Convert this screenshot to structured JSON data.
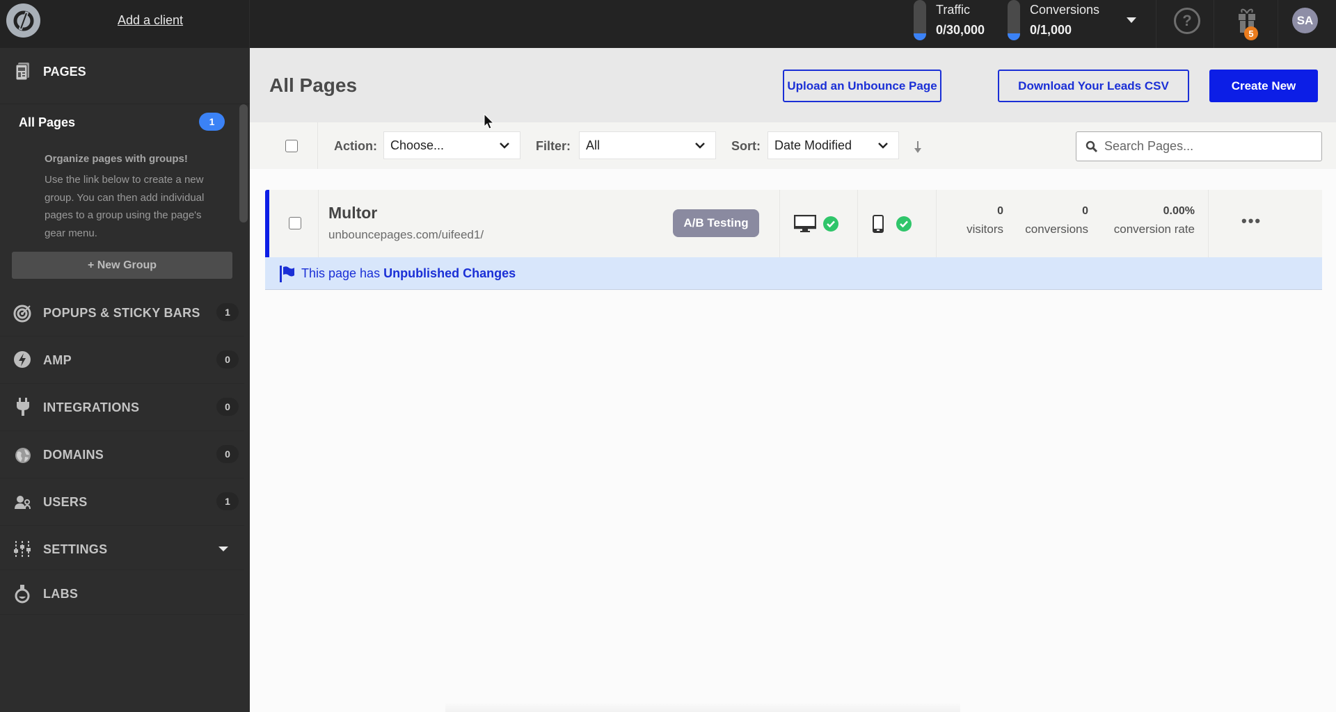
{
  "topbar": {
    "logo_icon": "unbounce-logo-icon",
    "add_client_label": "Add a client",
    "traffic": {
      "label": "Traffic",
      "value": "0/30,000",
      "fill_fraction": 0
    },
    "conversions": {
      "label": "Conversions",
      "value": "0/1,000",
      "fill_fraction": 0
    },
    "help_icon": "question-circle-icon",
    "help_glyph": "?",
    "gift_icon": "gift-icon",
    "gift_badge": "5",
    "avatar_initials": "SA"
  },
  "sidebar": {
    "pages_label": "PAGES",
    "all_pages": {
      "label": "All Pages",
      "count": "1"
    },
    "groups_help": {
      "title": "Organize pages with groups!",
      "text": "Use the link below to create a new group. You can then add individual pages to a group using the page's gear menu."
    },
    "new_group_label": "+ New Group",
    "items": [
      {
        "label": "POPUPS & STICKY BARS",
        "count": "1",
        "icon": "target-icon"
      },
      {
        "label": "AMP",
        "count": "0",
        "icon": "lightning-icon"
      },
      {
        "label": "INTEGRATIONS",
        "count": "0",
        "icon": "plug-icon"
      },
      {
        "label": "DOMAINS",
        "count": "0",
        "icon": "globe-icon"
      },
      {
        "label": "USERS",
        "count": "1",
        "icon": "users-icon"
      },
      {
        "label": "SETTINGS",
        "count": null,
        "icon": "sliders-icon"
      },
      {
        "label": "LABS",
        "count": null,
        "icon": "flask-icon"
      }
    ]
  },
  "main": {
    "title": "All Pages",
    "buttons": {
      "upload": "Upload an Unbounce Page",
      "download": "Download Your Leads CSV",
      "create": "Create New"
    },
    "toolbar": {
      "action_label": "Action:",
      "action_value": "Choose...",
      "filter_label": "Filter:",
      "filter_value": "All",
      "sort_label": "Sort:",
      "sort_value": "Date Modified",
      "search_placeholder": "Search Pages..."
    },
    "pages": [
      {
        "name": "Multor",
        "url": "unbouncepages.com/uifeed1/",
        "badge": "A/B Testing",
        "desktop_ok": true,
        "mobile_ok": true,
        "visitors": "0",
        "visitors_label": "visitors",
        "conversions": "0",
        "conversions_label": "conversions",
        "conversion_rate": "0.00%",
        "conversion_rate_label": "conversion rate",
        "more_label": "•••",
        "notice_prefix": "This page has ",
        "notice_bold": "Unpublished Changes"
      }
    ]
  },
  "colors": {
    "accent_blue": "#0c1ee6",
    "badge_blue": "#3b82f6",
    "success_green": "#2fc56a",
    "gift_badge_orange": "#ea7c1e",
    "notice_bg": "#d8e6fb"
  }
}
